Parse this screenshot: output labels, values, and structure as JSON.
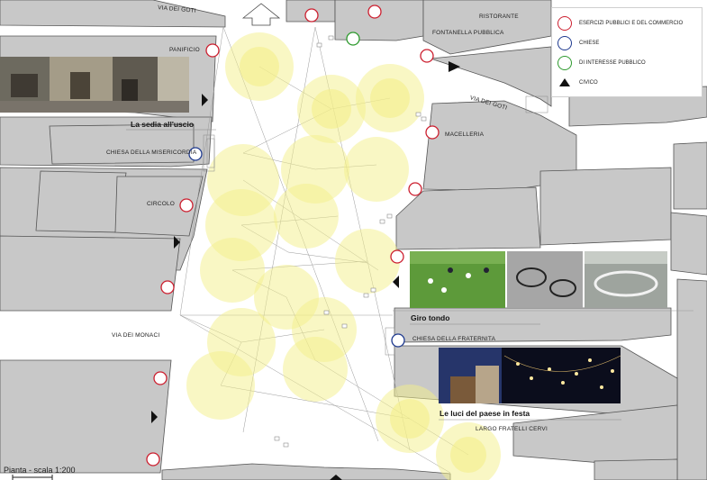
{
  "streets": {
    "goti_top": "VIA DEI GOTI",
    "goti_right": "VIA DEI GOTI",
    "monaci": "VIA DEI MONACI",
    "largo": "LARGO FRATELLI CERVI"
  },
  "places": {
    "ristorante": "RISTORANTE",
    "fontanella": "FONTANELLA PUBBLICA",
    "panificio": "PANIFICIO",
    "macelleria": "MACELLERIA",
    "misericordia": "CHIESA DELLA MISERICORDIA",
    "circolo": "CIRCOLO",
    "fraternita": "CHIESA DELLA FRATERNITA"
  },
  "captions": {
    "sedia": "La sedia all'uscio",
    "girotondo": "Giro tondo",
    "luci": "Le luci del paese in festa"
  },
  "legend": {
    "items": [
      {
        "label": "ESERCIZI PUBBLICI E DEL COMMERCIO",
        "symbol": "circle",
        "color": "#cc1f2f"
      },
      {
        "label": "CHIESE",
        "symbol": "circle",
        "color": "#1f3a8f"
      },
      {
        "label": "DI INTERESSE PUBBLICO",
        "symbol": "circle",
        "color": "#2e9a2e"
      },
      {
        "label": "CIVICO",
        "symbol": "triangle-icon",
        "color": "#111111"
      }
    ]
  },
  "scale": "Pianta - scala 1:200",
  "colors": {
    "building": "#c8c8c8",
    "building_edge": "#555555",
    "light": "#f4ef8a",
    "commerce": "#cc1f2f",
    "church": "#1f3a8f",
    "public": "#2e9a2e"
  }
}
